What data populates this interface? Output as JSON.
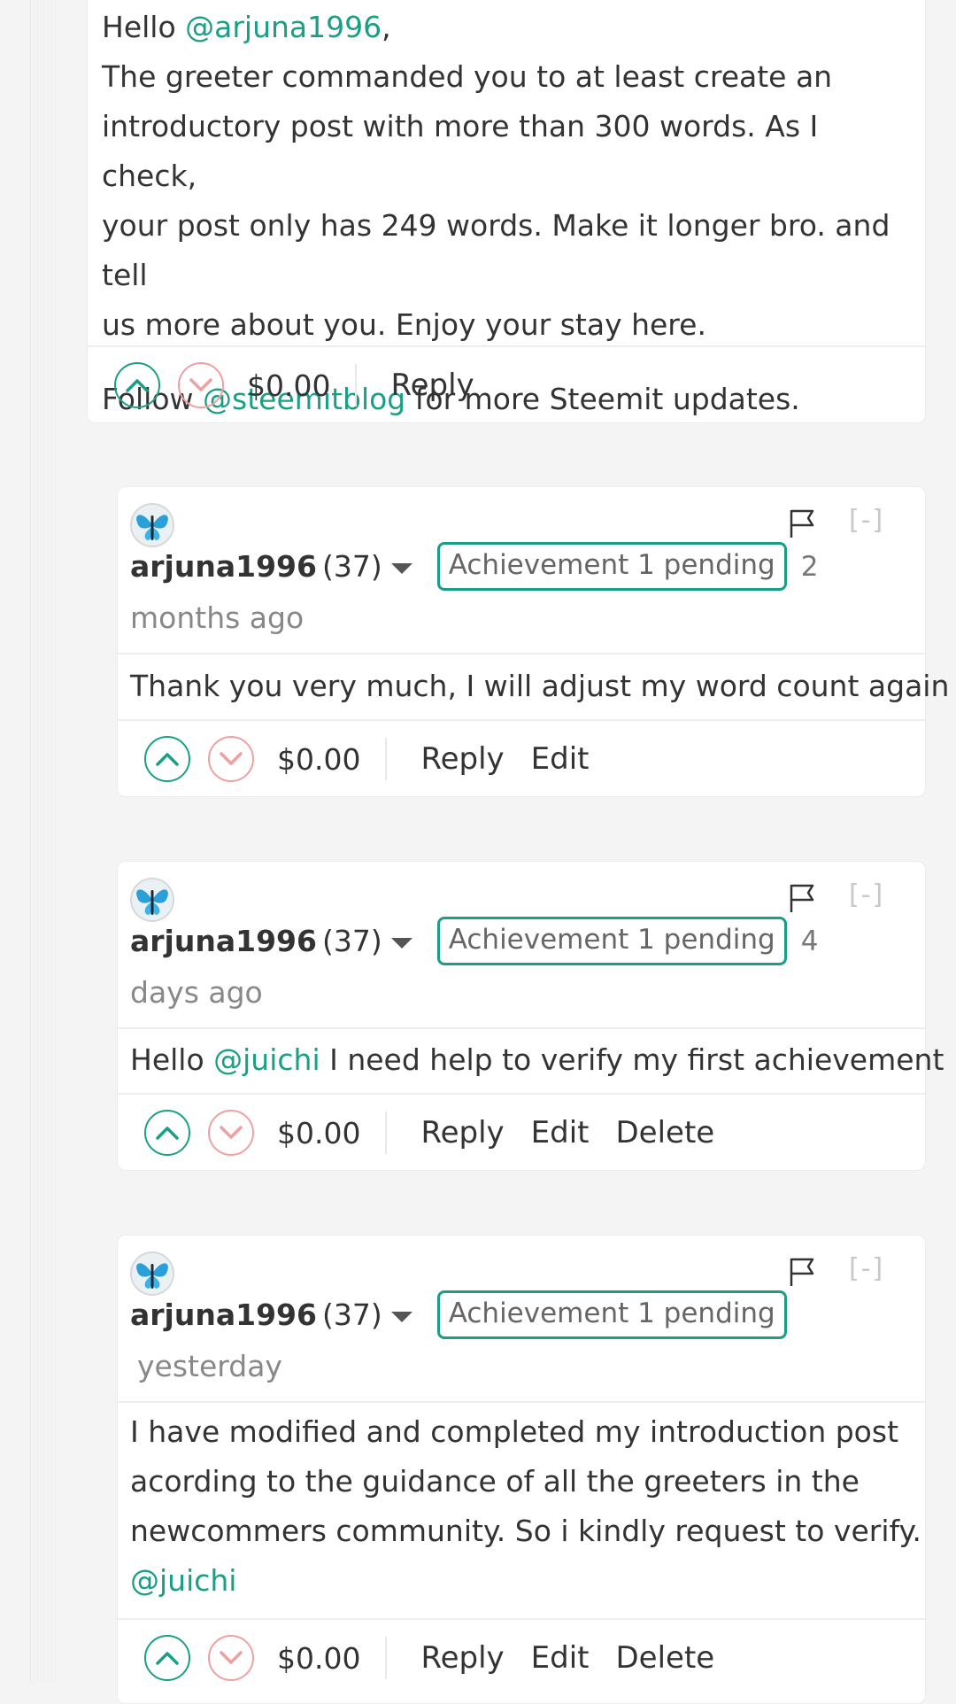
{
  "parent_comment": {
    "line1_prefix": "Hello ",
    "line1_mention": "@arjuna1996",
    "line1_suffix": ",",
    "body_lines": [
      "The greeter commanded you to at least create an",
      "introductory post with more than 300 words. As I check,",
      "your post only has 249 words. Make it longer bro. and tell",
      "us more about you. Enjoy your stay here."
    ],
    "follow_prefix": "Follow ",
    "follow_mention": "@steemitblog",
    "follow_suffix": " for more Steemit updates.",
    "payout": "$0.00",
    "reply_label": "Reply"
  },
  "replies": [
    {
      "author": "arjuna1996",
      "reputation": "(37)",
      "badge": "Achievement 1 pending",
      "time_prefix": "2",
      "time_line": "months ago",
      "body": "Thank you very much, I will adjust my word count again",
      "payout": "$0.00",
      "actions": [
        "Reply",
        "Edit"
      ],
      "collapse": "[-]"
    },
    {
      "author": "arjuna1996",
      "reputation": "(37)",
      "badge": "Achievement 1 pending",
      "time_prefix": "4",
      "time_line": "days ago",
      "body_prefix": "Hello ",
      "body_mention": "@juichi",
      "body_suffix": " I need help to verify my first achievement",
      "payout": "$0.00",
      "actions": [
        "Reply",
        "Edit",
        "Delete"
      ],
      "collapse": "[-]"
    },
    {
      "author": "arjuna1996",
      "reputation": "(37)",
      "badge": "Achievement 1 pending",
      "time_line": "yesterday",
      "body_lines": [
        "I have modified and completed my introduction post",
        "acording to the guidance of all the greeters in the",
        "newcommers community. So i kindly request to verify."
      ],
      "body_mention": "@juichi",
      "payout": "$0.00",
      "actions": [
        "Reply",
        "Edit",
        "Delete"
      ],
      "collapse": "[-]"
    }
  ],
  "colors": {
    "accent": "#1a9f86",
    "downvote": "#f0a0a0",
    "muted": "#888888"
  },
  "icons": {
    "upvote": "chevron-up-circle-icon",
    "downvote": "chevron-down-circle-icon",
    "flag": "flag-icon",
    "avatar": "butterfly-avatar"
  }
}
